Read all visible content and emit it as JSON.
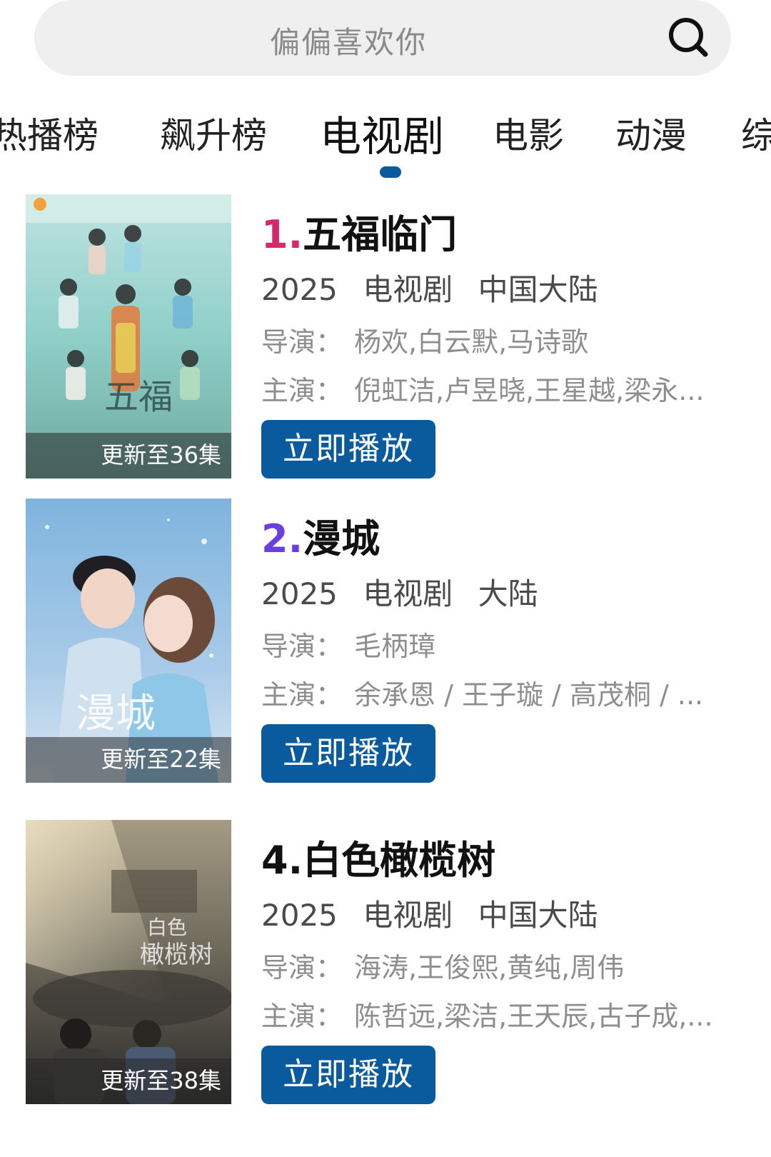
{
  "search": {
    "query": "偏偏喜欢你"
  },
  "tabs": [
    {
      "label": "热播榜"
    },
    {
      "label": "飙升榜"
    },
    {
      "label": "电视剧"
    },
    {
      "label": "电影"
    },
    {
      "label": "动漫"
    },
    {
      "label": "综"
    }
  ],
  "active_tab_index": 2,
  "colors": {
    "accent": "#0a5a9e",
    "rank1": "#d6286f",
    "rank2": "#6a3fe0",
    "rank_other": "#111111"
  },
  "items": [
    {
      "rank": "1.",
      "title": "五福临门",
      "year": "2025",
      "type": "电视剧",
      "region": "中国大陆",
      "director_label": "导演：",
      "directors": "杨欢,白云默,马诗歌",
      "cast_label": "主演：",
      "cast": "倪虹洁,卢昱晓,王星越,梁永...",
      "episode_badge": "更新至36集",
      "play_label": "立即播放"
    },
    {
      "rank": "2.",
      "title": "漫城",
      "year": "2025",
      "type": "电视剧",
      "region": "大陆",
      "director_label": "导演：",
      "directors": "毛柄璋",
      "cast_label": "主演：",
      "cast": "余承恩 / 王子璇 / 高茂桐 / ...",
      "episode_badge": "更新至22集",
      "play_label": "立即播放"
    },
    {
      "rank": "4.",
      "title": "白色橄榄树",
      "year": "2025",
      "type": "电视剧",
      "region": "中国大陆",
      "director_label": "导演：",
      "directors": "海涛,王俊熙,黄纯,周伟",
      "cast_label": "主演：",
      "cast": "陈哲远,梁洁,王天辰,古子成,...",
      "episode_badge": "更新至38集",
      "play_label": "立即播放"
    }
  ]
}
